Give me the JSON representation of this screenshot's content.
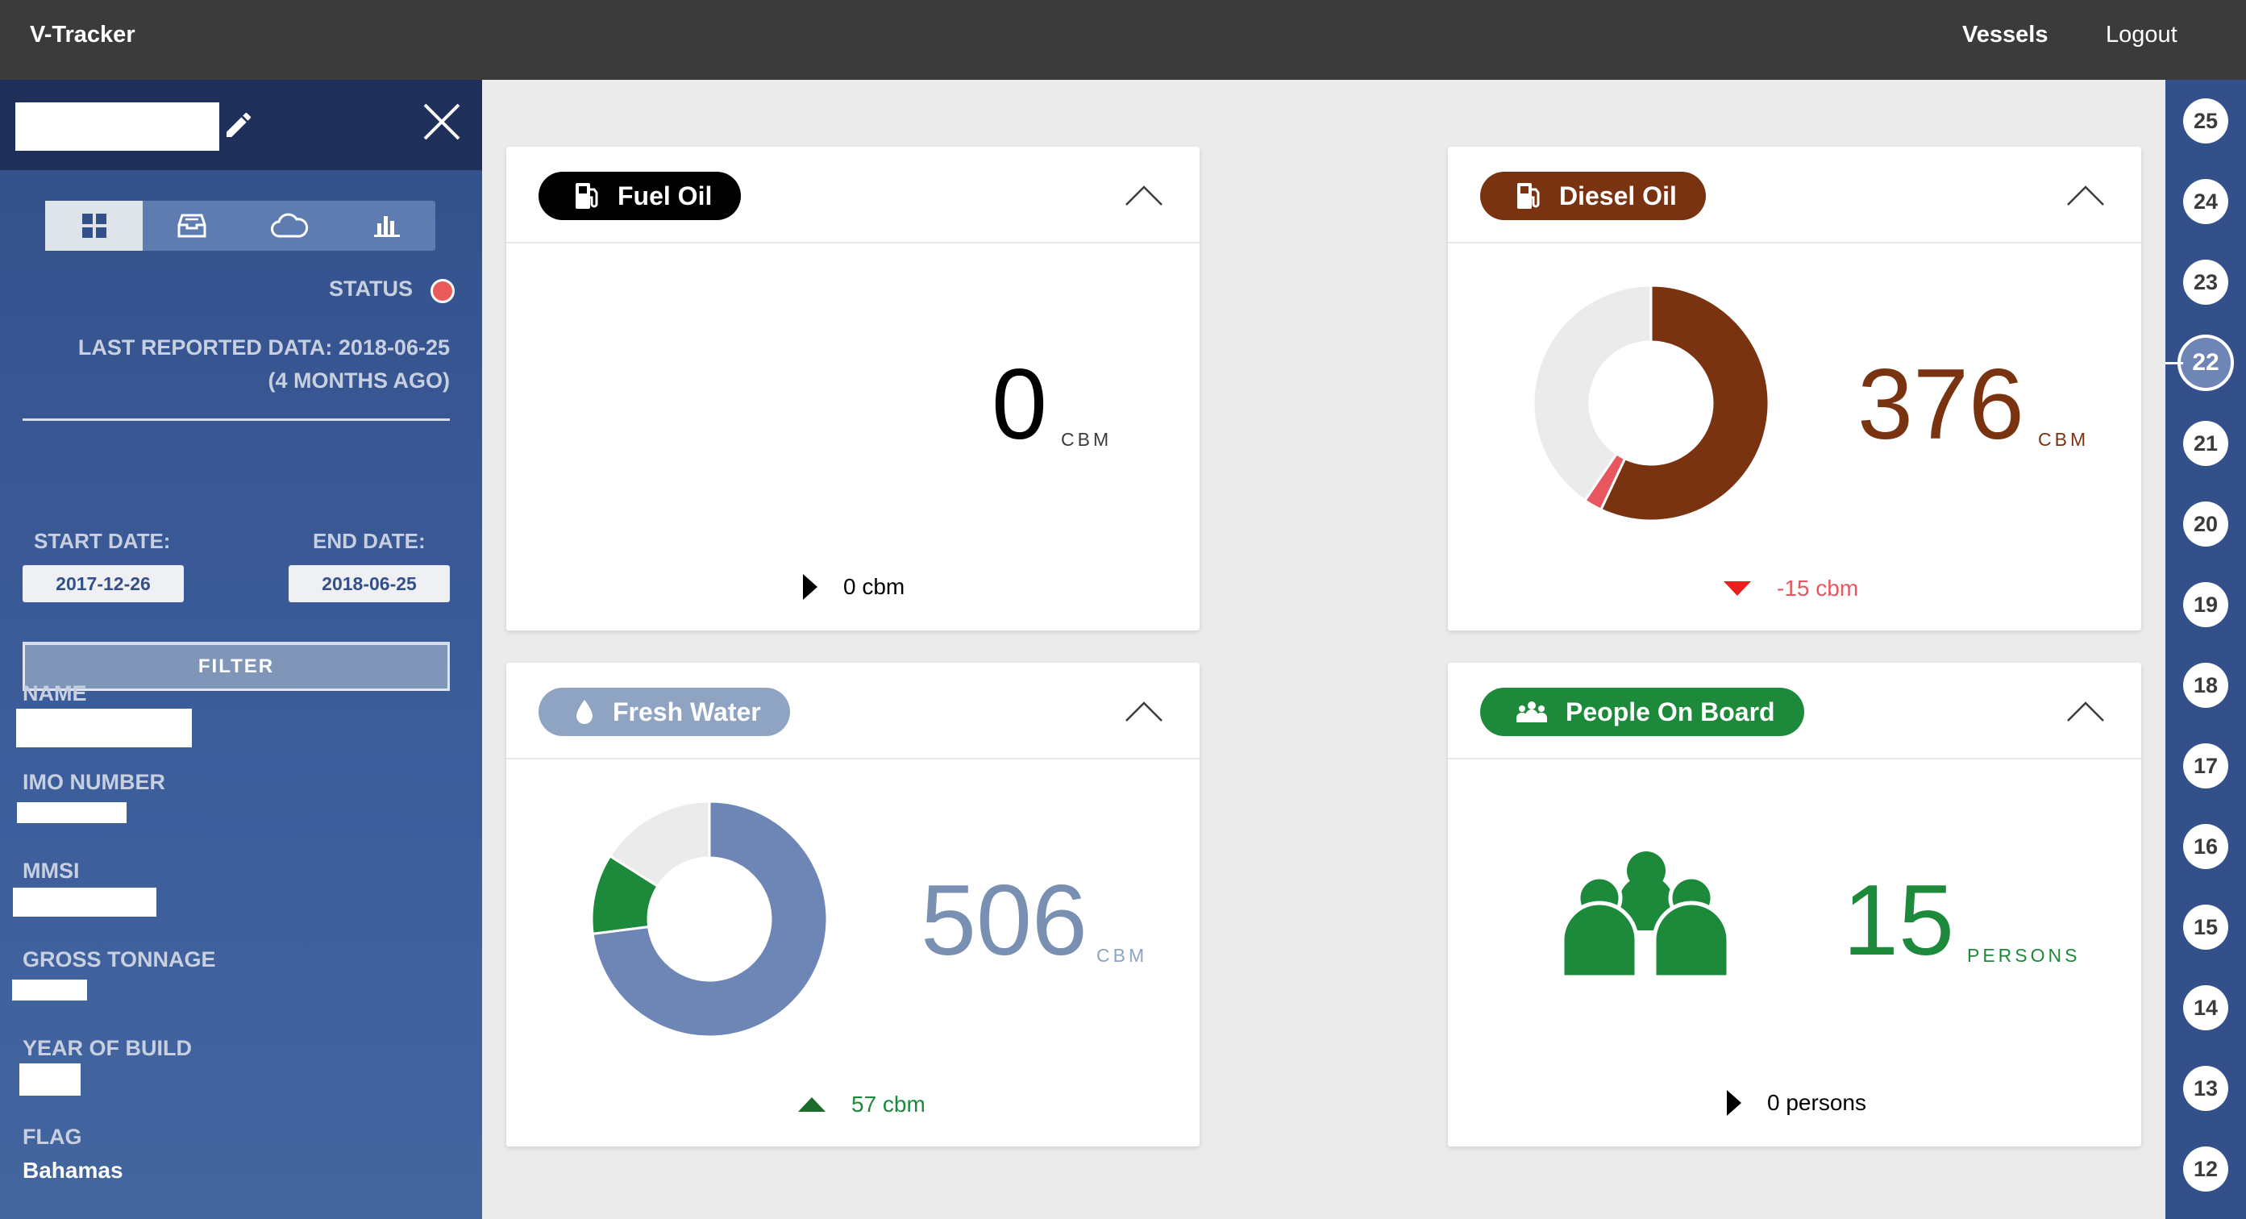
{
  "app": {
    "title": "V-Tracker"
  },
  "nav": {
    "vessels": "Vessels",
    "logout": "Logout"
  },
  "sidebar": {
    "status_label": "STATUS",
    "status_color": "#ea5a5a",
    "last_reported_line1": "LAST REPORTED DATA: 2018-06-25",
    "last_reported_line2": "(4 MONTHS AGO)",
    "start_date_label": "START DATE:",
    "end_date_label": "END DATE:",
    "start_date": "2017-12-26",
    "end_date": "2018-06-25",
    "filter_label": "FILTER",
    "view_tabs": [
      "dashboard-icon",
      "inbox-icon",
      "cloud-icon",
      "bar-chart-icon"
    ],
    "fields": {
      "name": "NAME",
      "imo": "IMO NUMBER",
      "mmsi": "MMSI",
      "gross_tonnage": "GROSS TONNAGE",
      "year_of_build": "YEAR OF BUILD",
      "flag": "FLAG",
      "flag_value": "Bahamas"
    }
  },
  "cards": {
    "fuel_oil": {
      "title": "Fuel Oil",
      "value": "0",
      "unit": "CBM",
      "delta": "0 cbm",
      "trend": "flat",
      "color": "#000000"
    },
    "diesel_oil": {
      "title": "Diesel Oil",
      "value": "376",
      "unit": "CBM",
      "delta": "-15 cbm",
      "trend": "down",
      "color": "#7a3311",
      "delta_color": "#e8575f"
    },
    "fresh_water": {
      "title": "Fresh Water",
      "value": "506",
      "unit": "CBM",
      "delta": "57 cbm",
      "trend": "up",
      "color": "#6d86b5",
      "pill_color": "#8fa3c2",
      "delta_color": "#1c8a3a"
    },
    "people_on_board": {
      "title": "People On Board",
      "value": "15",
      "unit": "PERSONS",
      "delta": "0 persons",
      "trend": "flat",
      "color": "#1c8a3a"
    }
  },
  "chart_data": [
    {
      "type": "pie",
      "title": "Diesel Oil",
      "slices": [
        {
          "name": "current",
          "value": 0.57,
          "color": "#7a3311"
        },
        {
          "name": "consumed",
          "value": 0.025,
          "color": "#e8575f"
        },
        {
          "name": "remaining-capacity",
          "value": 0.405,
          "color": "#ebebeb"
        }
      ]
    },
    {
      "type": "pie",
      "title": "Fresh Water",
      "slices": [
        {
          "name": "current",
          "value": 0.73,
          "color": "#6d86b5"
        },
        {
          "name": "added",
          "value": 0.11,
          "color": "#1c8a3a"
        },
        {
          "name": "remaining-capacity",
          "value": 0.16,
          "color": "#ebebeb"
        }
      ]
    }
  ],
  "timeline": {
    "days": [
      "25",
      "24",
      "23",
      "22",
      "21",
      "20",
      "19",
      "18",
      "17",
      "16",
      "15",
      "14",
      "13",
      "12"
    ],
    "active": "22"
  }
}
